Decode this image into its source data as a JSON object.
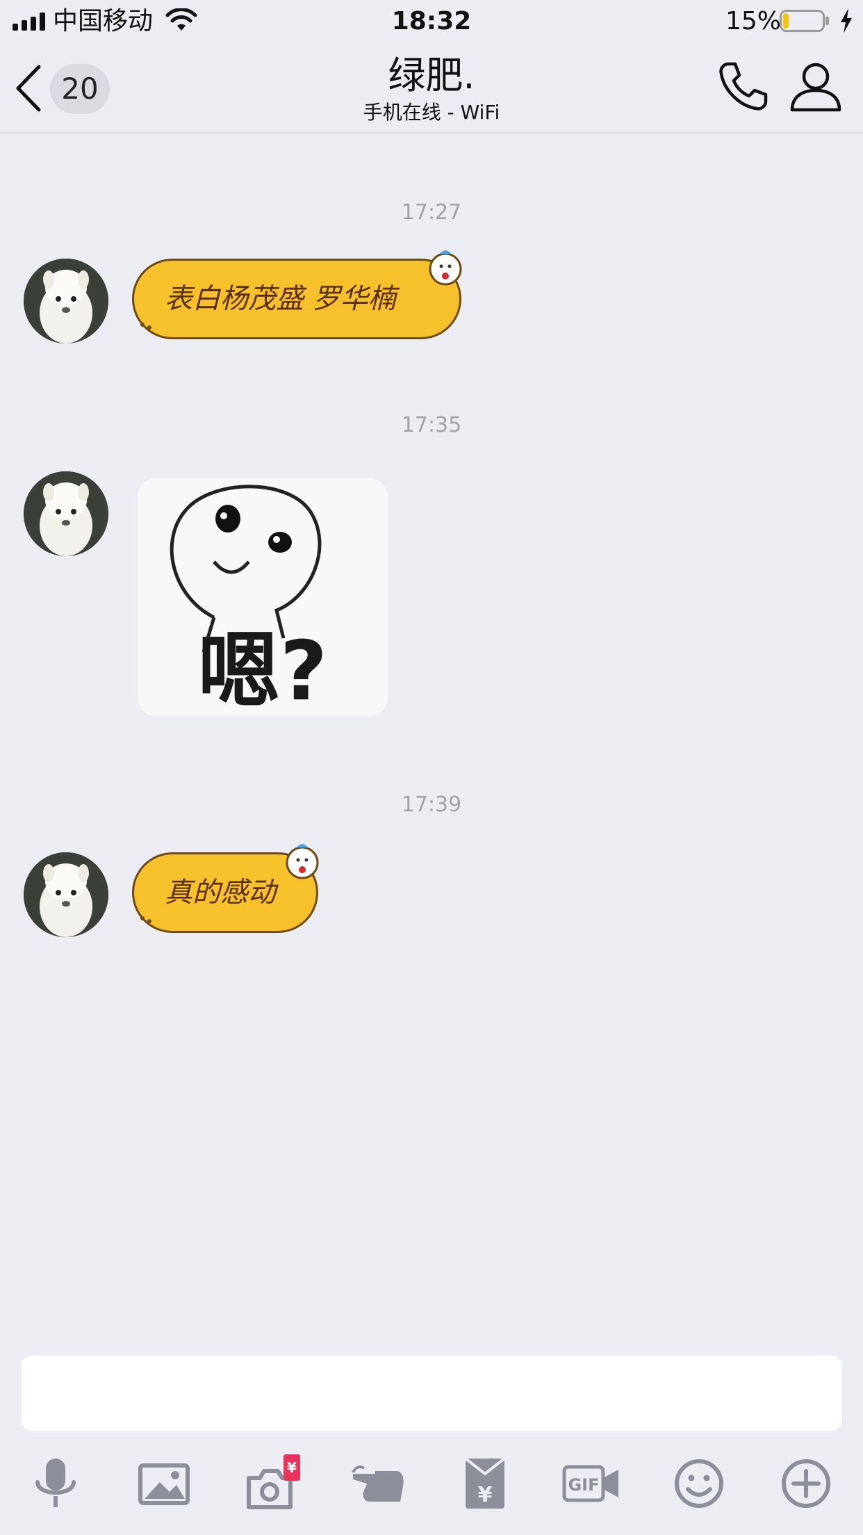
{
  "status_bar": {
    "carrier": "中国移动",
    "time": "18:32",
    "battery_percent": "15%",
    "battery_level": 0.15,
    "battery_color": "#f5c400"
  },
  "header": {
    "unread_count": "20",
    "contact_name": "绿肥.",
    "contact_status": "手机在线 - WiFi"
  },
  "messages": [
    {
      "time": "17:27",
      "type": "text",
      "text": "表白杨茂盛 罗华楠"
    },
    {
      "time": "17:35",
      "type": "image",
      "image_text": "嗯?"
    },
    {
      "time": "17:39",
      "type": "text",
      "text": "真的感动"
    }
  ],
  "toolbar": {
    "icons": [
      "microphone-icon",
      "image-icon",
      "camera-icon",
      "poke-icon",
      "red-packet-icon",
      "gif-icon",
      "emoji-icon",
      "plus-icon"
    ],
    "camera_badge": "¥"
  },
  "colors": {
    "background": "#ebedf2",
    "bubble": "#f6c12b",
    "icon": "#8c8f99",
    "badge_red": "#e8335a"
  }
}
